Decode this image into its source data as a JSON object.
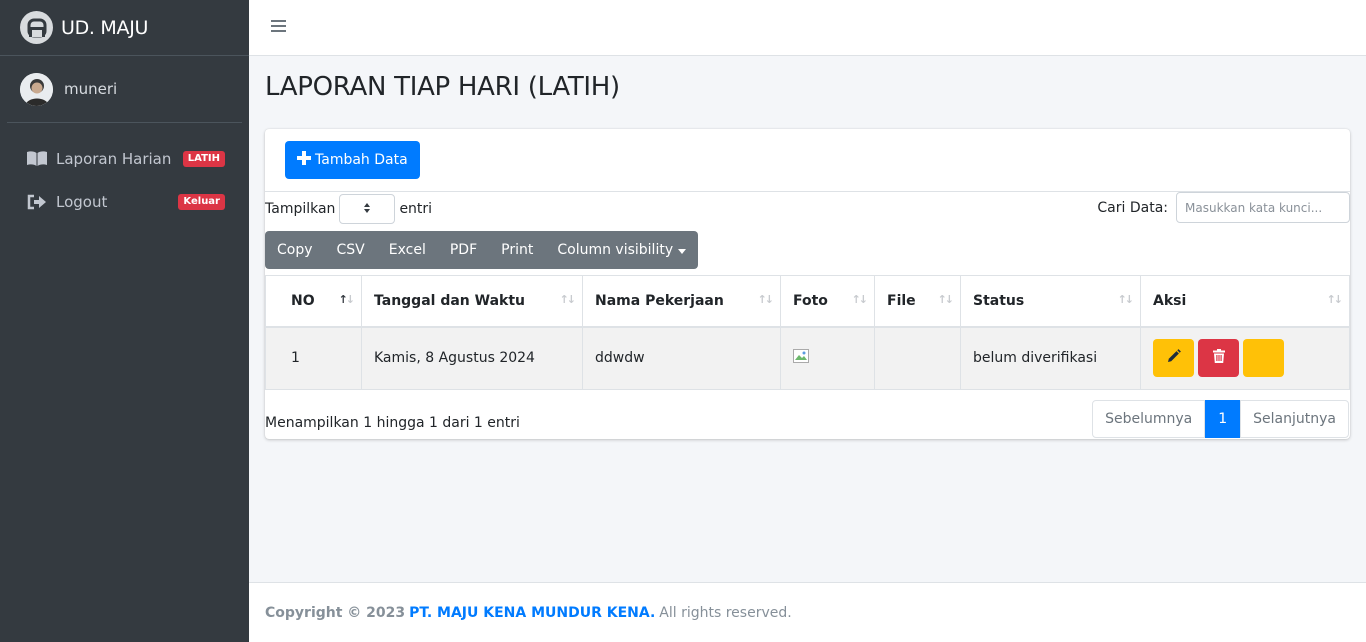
{
  "brand": {
    "title": "UD. MAJU"
  },
  "user": {
    "name": "muneri"
  },
  "sidebar": {
    "items": [
      {
        "label": "Laporan Harian",
        "badge": "LATIH",
        "icon": "book-icon"
      },
      {
        "label": "Logout",
        "badge": "Keluar",
        "icon": "sign-out-icon"
      }
    ]
  },
  "page": {
    "title": "LAPORAN TIAP HARI (LATIH)"
  },
  "toolbar": {
    "add_label": "Tambah Data"
  },
  "length": {
    "prefix": "Tampilkan",
    "suffix": "entri"
  },
  "search": {
    "label": "Cari Data:",
    "placeholder": "Masukkan kata kunci..."
  },
  "export_buttons": [
    "Copy",
    "CSV",
    "Excel",
    "PDF",
    "Print",
    "Column visibility"
  ],
  "table": {
    "columns": [
      "NO",
      "Tanggal dan Waktu",
      "Nama Pekerjaan",
      "Foto",
      "File",
      "Status",
      "Aksi"
    ],
    "rows": [
      {
        "no": "1",
        "tanggal": "Kamis, 8 Agustus 2024",
        "nama": "ddwdw",
        "foto": "",
        "file": "",
        "status": "belum diverifikasi"
      }
    ]
  },
  "info": "Menampilkan 1 hingga 1 dari 1 entri",
  "pagination": {
    "prev": "Sebelumnya",
    "current": "1",
    "next": "Selanjutnya"
  },
  "footer": {
    "copyright": "Copyright © 2023",
    "company": "PT. MAJU KENA MUNDUR KENA.",
    "rights": "All rights reserved."
  },
  "colors": {
    "primary": "#007bff",
    "danger": "#dc3545",
    "warning": "#ffc107",
    "secondary": "#6c757d",
    "sidebar": "#343a40"
  }
}
